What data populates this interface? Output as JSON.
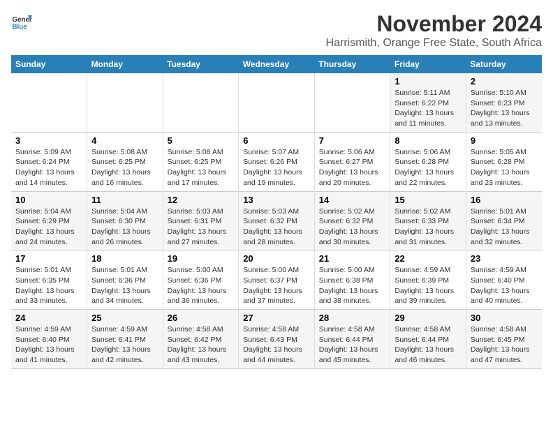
{
  "logo": {
    "line1": "General",
    "line2": "Blue"
  },
  "title": "November 2024",
  "subtitle": "Harrismith, Orange Free State, South Africa",
  "days_header": [
    "Sunday",
    "Monday",
    "Tuesday",
    "Wednesday",
    "Thursday",
    "Friday",
    "Saturday"
  ],
  "weeks": [
    [
      {
        "day": "",
        "detail": ""
      },
      {
        "day": "",
        "detail": ""
      },
      {
        "day": "",
        "detail": ""
      },
      {
        "day": "",
        "detail": ""
      },
      {
        "day": "",
        "detail": ""
      },
      {
        "day": "1",
        "detail": "Sunrise: 5:11 AM\nSunset: 6:22 PM\nDaylight: 13 hours\nand 11 minutes."
      },
      {
        "day": "2",
        "detail": "Sunrise: 5:10 AM\nSunset: 6:23 PM\nDaylight: 13 hours\nand 13 minutes."
      }
    ],
    [
      {
        "day": "3",
        "detail": "Sunrise: 5:09 AM\nSunset: 6:24 PM\nDaylight: 13 hours\nand 14 minutes."
      },
      {
        "day": "4",
        "detail": "Sunrise: 5:08 AM\nSunset: 6:25 PM\nDaylight: 13 hours\nand 16 minutes."
      },
      {
        "day": "5",
        "detail": "Sunrise: 5:08 AM\nSunset: 6:25 PM\nDaylight: 13 hours\nand 17 minutes."
      },
      {
        "day": "6",
        "detail": "Sunrise: 5:07 AM\nSunset: 6:26 PM\nDaylight: 13 hours\nand 19 minutes."
      },
      {
        "day": "7",
        "detail": "Sunrise: 5:06 AM\nSunset: 6:27 PM\nDaylight: 13 hours\nand 20 minutes."
      },
      {
        "day": "8",
        "detail": "Sunrise: 5:06 AM\nSunset: 6:28 PM\nDaylight: 13 hours\nand 22 minutes."
      },
      {
        "day": "9",
        "detail": "Sunrise: 5:05 AM\nSunset: 6:28 PM\nDaylight: 13 hours\nand 23 minutes."
      }
    ],
    [
      {
        "day": "10",
        "detail": "Sunrise: 5:04 AM\nSunset: 6:29 PM\nDaylight: 13 hours\nand 24 minutes."
      },
      {
        "day": "11",
        "detail": "Sunrise: 5:04 AM\nSunset: 6:30 PM\nDaylight: 13 hours\nand 26 minutes."
      },
      {
        "day": "12",
        "detail": "Sunrise: 5:03 AM\nSunset: 6:31 PM\nDaylight: 13 hours\nand 27 minutes."
      },
      {
        "day": "13",
        "detail": "Sunrise: 5:03 AM\nSunset: 6:32 PM\nDaylight: 13 hours\nand 28 minutes."
      },
      {
        "day": "14",
        "detail": "Sunrise: 5:02 AM\nSunset: 6:32 PM\nDaylight: 13 hours\nand 30 minutes."
      },
      {
        "day": "15",
        "detail": "Sunrise: 5:02 AM\nSunset: 6:33 PM\nDaylight: 13 hours\nand 31 minutes."
      },
      {
        "day": "16",
        "detail": "Sunrise: 5:01 AM\nSunset: 6:34 PM\nDaylight: 13 hours\nand 32 minutes."
      }
    ],
    [
      {
        "day": "17",
        "detail": "Sunrise: 5:01 AM\nSunset: 6:35 PM\nDaylight: 13 hours\nand 33 minutes."
      },
      {
        "day": "18",
        "detail": "Sunrise: 5:01 AM\nSunset: 6:36 PM\nDaylight: 13 hours\nand 34 minutes."
      },
      {
        "day": "19",
        "detail": "Sunrise: 5:00 AM\nSunset: 6:36 PM\nDaylight: 13 hours\nand 36 minutes."
      },
      {
        "day": "20",
        "detail": "Sunrise: 5:00 AM\nSunset: 6:37 PM\nDaylight: 13 hours\nand 37 minutes."
      },
      {
        "day": "21",
        "detail": "Sunrise: 5:00 AM\nSunset: 6:38 PM\nDaylight: 13 hours\nand 38 minutes."
      },
      {
        "day": "22",
        "detail": "Sunrise: 4:59 AM\nSunset: 6:39 PM\nDaylight: 13 hours\nand 39 minutes."
      },
      {
        "day": "23",
        "detail": "Sunrise: 4:59 AM\nSunset: 6:40 PM\nDaylight: 13 hours\nand 40 minutes."
      }
    ],
    [
      {
        "day": "24",
        "detail": "Sunrise: 4:59 AM\nSunset: 6:40 PM\nDaylight: 13 hours\nand 41 minutes."
      },
      {
        "day": "25",
        "detail": "Sunrise: 4:59 AM\nSunset: 6:41 PM\nDaylight: 13 hours\nand 42 minutes."
      },
      {
        "day": "26",
        "detail": "Sunrise: 4:58 AM\nSunset: 6:42 PM\nDaylight: 13 hours\nand 43 minutes."
      },
      {
        "day": "27",
        "detail": "Sunrise: 4:58 AM\nSunset: 6:43 PM\nDaylight: 13 hours\nand 44 minutes."
      },
      {
        "day": "28",
        "detail": "Sunrise: 4:58 AM\nSunset: 6:44 PM\nDaylight: 13 hours\nand 45 minutes."
      },
      {
        "day": "29",
        "detail": "Sunrise: 4:58 AM\nSunset: 6:44 PM\nDaylight: 13 hours\nand 46 minutes."
      },
      {
        "day": "30",
        "detail": "Sunrise: 4:58 AM\nSunset: 6:45 PM\nDaylight: 13 hours\nand 47 minutes."
      }
    ]
  ]
}
